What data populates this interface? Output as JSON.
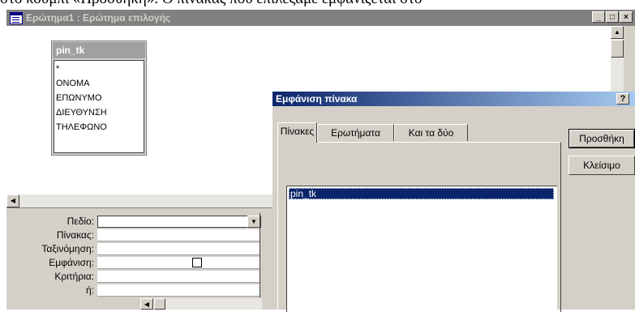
{
  "page_caption": "στο κουμπί «Προσθήκη». Ο πίνακας που επιλέξαμε εμφανίζεται στο",
  "query_window": {
    "title": "Ερώτημα1 : Ερώτημα επιλογής",
    "buttons": {
      "minimize": "_",
      "maximize": "□",
      "close": "×"
    }
  },
  "table_window": {
    "name": "pin_tk",
    "fields": [
      "*",
      "ΟΝΟΜΑ",
      "ΕΠΩΝΥΜΟ",
      "ΔΙΕΥΘΥΝΣΗ",
      "ΤΗΛΕΦΩΝΟ"
    ]
  },
  "grid": {
    "row_labels": [
      "Πεδίο:",
      "Πίνακας:",
      "Ταξινόμηση:",
      "Εμφάνιση:",
      "Κριτήρια:",
      "ή:"
    ]
  },
  "dialog": {
    "title": "Εμφάνιση πίνακα",
    "help": "?",
    "tabs": [
      {
        "label": "Πίνακες",
        "active": true
      },
      {
        "label": "Ερωτήματα",
        "active": false
      },
      {
        "label": "Και τα δύο",
        "active": false
      }
    ],
    "list_items": [
      "pin_tk"
    ],
    "selected_item": "pin_tk",
    "buttons": {
      "add": "Προσθήκη",
      "close": "Κλείσιμο"
    }
  },
  "icons": {
    "scroll_up": "arrow-up-icon",
    "scroll_left": "arrow-left-icon",
    "dropdown": "chevron-down-icon",
    "app": "query-icon"
  },
  "colors": {
    "inactive_title": "#808080",
    "active_title_start": "#0a246a",
    "active_title_end": "#a6caf0",
    "face": "#d4d0c8",
    "selection": "#0a246a"
  }
}
